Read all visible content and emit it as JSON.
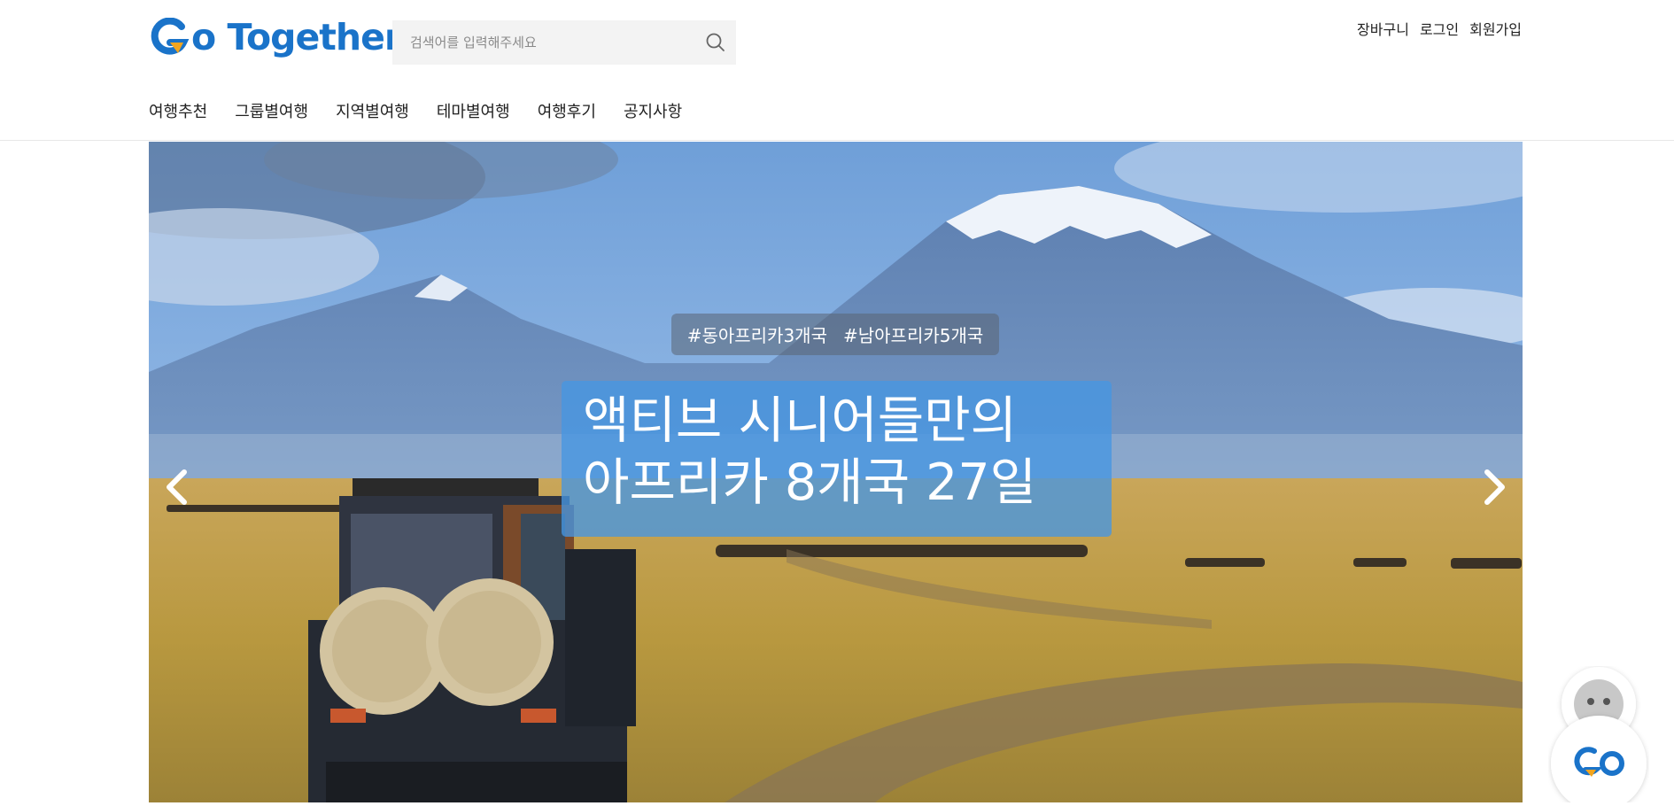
{
  "brand": {
    "name": "Go Together",
    "primary_color": "#1a73c9",
    "accent_color": "#f2a51f"
  },
  "search": {
    "placeholder": "검색어를 입력해주세요",
    "value": "",
    "icon": "search-icon"
  },
  "util_menu": [
    {
      "label": "장바구니"
    },
    {
      "label": "로그인"
    },
    {
      "label": "회원가입"
    }
  ],
  "nav": [
    {
      "label": "여행추천"
    },
    {
      "label": "그룹별여행"
    },
    {
      "label": "지역별여행"
    },
    {
      "label": "테마별여행"
    },
    {
      "label": "여행후기"
    },
    {
      "label": "공지사항"
    }
  ],
  "hero": {
    "tags": [
      "#동아프리카3개국",
      "#남아프리카5개국"
    ],
    "headline_line1": "액티브 시니어들만의",
    "headline_line2": "아프리카 8개국 27일",
    "prev_icon": "chevron-left-icon",
    "next_icon": "chevron-right-icon"
  },
  "chatbot": {
    "logo_text": "Go",
    "icon": "chatbot-icon"
  }
}
